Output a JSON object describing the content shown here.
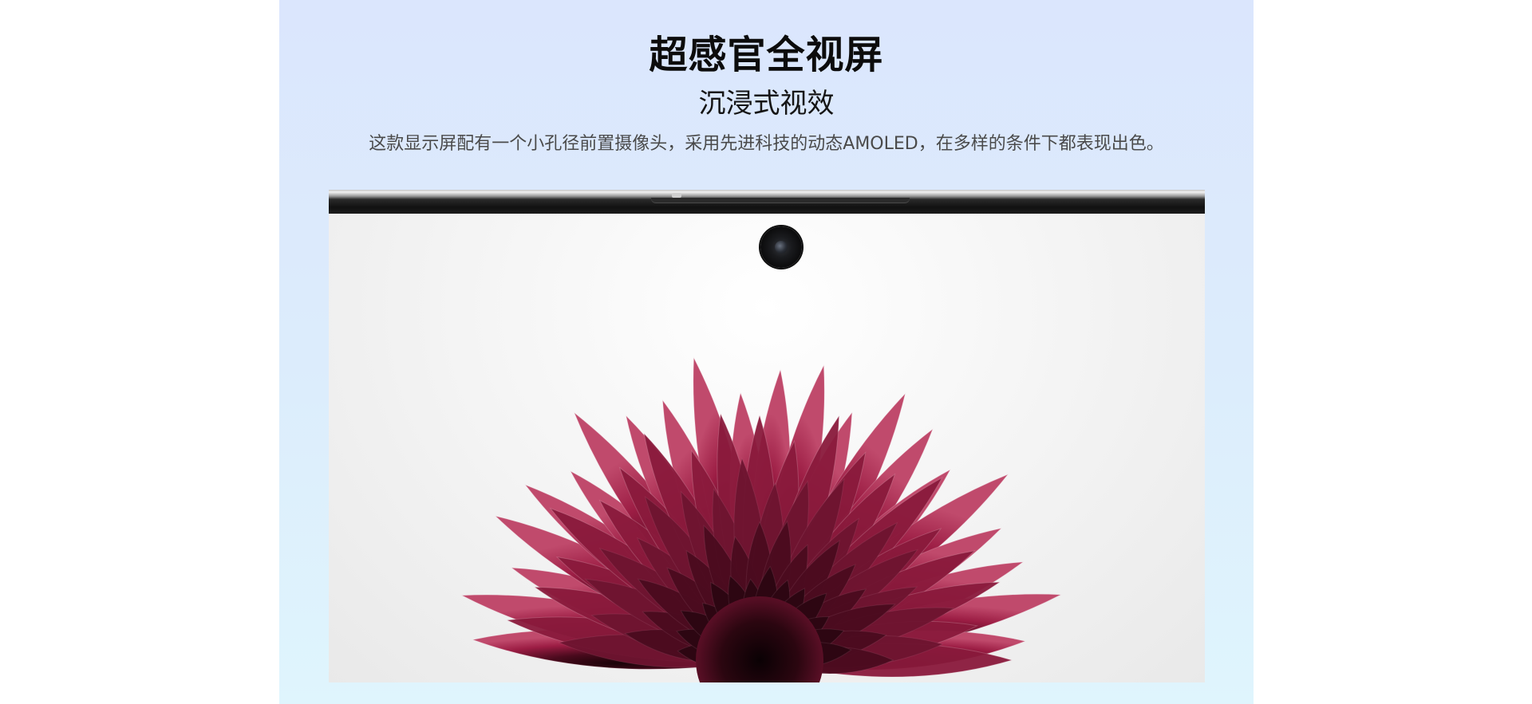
{
  "hero": {
    "title": "超感官全视屏",
    "subtitle": "沉浸式视效",
    "description": "这款显示屏配有一个小孔径前置摄像头，采用先进科技的动态AMOLED，在多样的条件下都表现出色。"
  },
  "image": {
    "icon_names": [
      "punch-hole-camera-icon",
      "flower-illustration"
    ],
    "colors": {
      "panel_top": "#dbe6fd",
      "panel_bottom": "#dff5fd",
      "flower_petal": "#9c1d44",
      "flower_dark": "#2b0610"
    }
  }
}
